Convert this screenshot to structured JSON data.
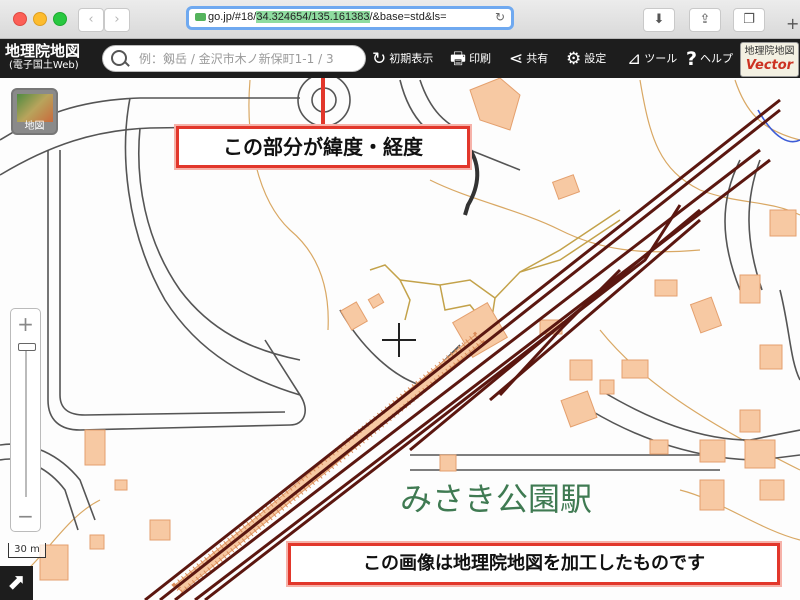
{
  "browser": {
    "nav_back": "‹",
    "nav_forward": "›",
    "url_prefix": "go.jp/#18/",
    "url_coords": "34.324654/135.161383",
    "url_suffix": "/&base=std&ls=",
    "reload": "↻",
    "download": "⬇",
    "share": "⇪",
    "tabs": "❐",
    "new_tab": "+"
  },
  "app": {
    "logo_main": "地理院地図",
    "logo_sub": "(電子国土Web)",
    "search_placeholder": "例：剱岳 / 金沢市木ノ新保町1-1 / 3",
    "toolbar": {
      "reset": "初期表示",
      "print": "印刷",
      "share": "共有",
      "settings": "設定",
      "tools": "ツール",
      "help": "ヘルプ"
    },
    "vector_line1": "地理院地図",
    "vector_line2": "Vector"
  },
  "map": {
    "layer_label": "地図",
    "zoom_in": "+",
    "zoom_out": "−",
    "scale_label": "30 m",
    "station_label": "みさき公園駅",
    "crosshair": "十",
    "callout_top": "この部分が緯度・経度",
    "callout_bottom": "この画像は地理院地図を加工したものです",
    "colors": {
      "rail": "#5b1710",
      "road": "#555555",
      "building": "#f7c9a3",
      "contour": "#d9a864",
      "boundary": "#c3a24a",
      "water": "#3d5cd6",
      "label": "#3f7a52",
      "callout_border": "#e2372b"
    }
  }
}
